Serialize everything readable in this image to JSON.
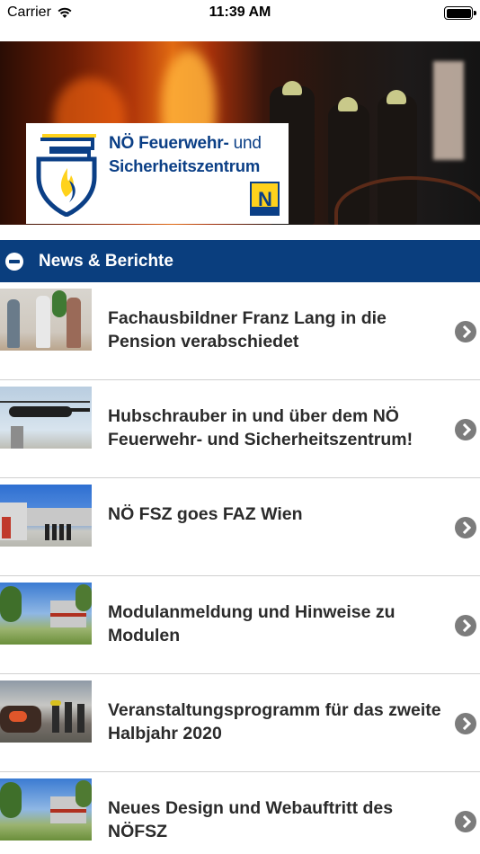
{
  "status_bar": {
    "carrier": "Carrier",
    "time": "11:39 AM",
    "wifi_icon": "wifi-icon",
    "battery_icon": "battery-icon"
  },
  "hero": {
    "logo": {
      "line1_bold": "NÖ Feuerwehr-",
      "line1_light": " und",
      "line2": "Sicherheitszentrum",
      "badge_letter": "N"
    }
  },
  "section": {
    "title": "News & Berichte",
    "collapse_icon": "minus-circle-icon",
    "header_color": "#0a3e7e"
  },
  "news": [
    {
      "title": "Fachausbildner Franz Lang in die Pension verabschiedet"
    },
    {
      "title": "Hubschrauber in und über dem NÖ Feuerwehr- und Sicherheitszentrum!"
    },
    {
      "title": "NÖ FSZ goes FAZ Wien"
    },
    {
      "title": "Modulanmeldung und Hinweise zu Modulen"
    },
    {
      "title": "Veranstaltungsprogramm für das zweite Halbjahr 2020"
    },
    {
      "title": "Neues Design und Webauftritt des NÖFSZ"
    }
  ],
  "chevron_icon": "chevron-right-circle-icon",
  "colors": {
    "accent": "#0a3e7e",
    "chevron": "#7c7c7c",
    "logo_yellow": "#ffd21c"
  }
}
